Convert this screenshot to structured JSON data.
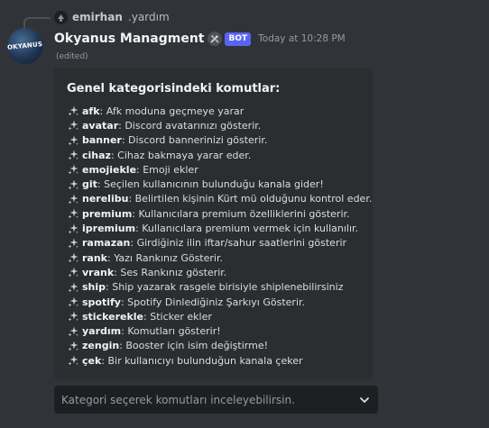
{
  "reply": {
    "author": "emirhan",
    "text": ".yardım"
  },
  "message": {
    "author": "Okyanus Managment",
    "avatar_text": "OKYANUS",
    "tool_icon": "tools-icon",
    "bot_tag": "BOT",
    "timestamp": "Today at 10:28 PM",
    "edited": "(edited)"
  },
  "embed": {
    "title": "Genel kategorisindeki komutlar:",
    "bullet_icon": "sparkles-icon",
    "commands": [
      {
        "name": "afk",
        "desc": ": Afk moduna geçmeye yarar"
      },
      {
        "name": "avatar",
        "desc": ": Discord avatarınızı gösterir."
      },
      {
        "name": "banner",
        "desc": ": Discord bannerinizi gösterir."
      },
      {
        "name": "cihaz",
        "desc": ": Cihaz bakmaya yarar eder."
      },
      {
        "name": "emojiekle",
        "desc": ": Emoji ekler"
      },
      {
        "name": "git",
        "desc": ": Seçilen kullanıcının bulunduğu kanala gider!"
      },
      {
        "name": "nerelibu",
        "desc": ": Belirtilen kişinin Kürt mü olduğunu kontrol eder."
      },
      {
        "name": "premium",
        "desc": ": Kullanıcılara premium özelliklerini gösterir."
      },
      {
        "name": "ipremium",
        "desc": ": Kullanıcılara premium vermek için kullanılır."
      },
      {
        "name": "ramazan",
        "desc": ": Girdiğiniz ilin iftar/sahur saatlerini gösterir"
      },
      {
        "name": "rank",
        "desc": ": Yazı Rankınız Gösterir."
      },
      {
        "name": "vrank",
        "desc": ": Ses Rankınız gösterir."
      },
      {
        "name": "ship",
        "desc": ": Ship yazarak rasgele birisiyle shiplenebilirsiniz"
      },
      {
        "name": "spotify",
        "desc": ": Spotify Dinlediğiniz Şarkıyı Gösterir."
      },
      {
        "name": "stickerekle",
        "desc": ": Sticker ekler"
      },
      {
        "name": "yardım",
        "desc": ": Komutları gösterir!"
      },
      {
        "name": "zengin",
        "desc": ": Booster için isim değiştirme!"
      },
      {
        "name": "çek",
        "desc": ": Bir kullanıcıyı bulunduğun kanala çeker"
      }
    ]
  },
  "select_menu": {
    "placeholder": "Kategori seçerek komutları inceleyebilirsin.",
    "icon": "chevron-down-icon"
  },
  "colors": {
    "background": "#323338",
    "embed_bg": "#2b2d31",
    "bot_tag": "#5865f2",
    "select_bg": "#1e1f22"
  }
}
